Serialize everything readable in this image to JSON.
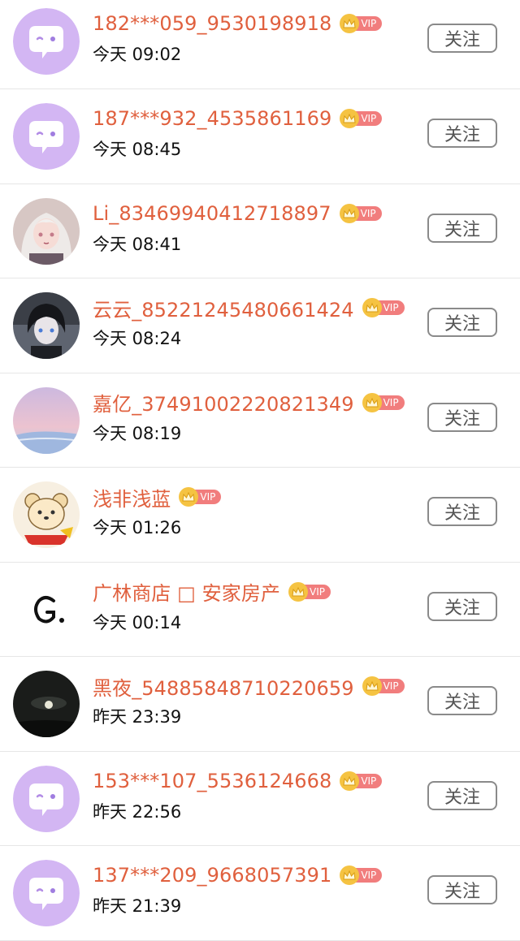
{
  "colors": {
    "username": "#e0603e",
    "vip_gold": "#f5c342",
    "vip_tag": "#f17d7d",
    "border": "#e6e6e6"
  },
  "follow_label": "关注",
  "vip_label": "VIP",
  "users": [
    {
      "name": "182***059_9530198918",
      "time": "今天 09:02",
      "avatar": "default-chat-avatar"
    },
    {
      "name": "187***932_4535861169",
      "time": "今天 08:45",
      "avatar": "default-chat-avatar"
    },
    {
      "name": "Li_83469940412718897",
      "time": "今天 08:41",
      "avatar": "anime-girl-avatar"
    },
    {
      "name": "云云_85221245480661424",
      "time": "今天 08:24",
      "avatar": "dark-hair-anime-avatar"
    },
    {
      "name": "嘉亿_37491002220821349",
      "time": "今天 08:19",
      "avatar": "pink-sky-avatar"
    },
    {
      "name": "浅非浅蓝",
      "time": "今天 01:26",
      "avatar": "bear-cartoon-avatar"
    },
    {
      "name": "广林商店 □ 安家房产",
      "time": "今天 00:14",
      "avatar": "letter-g-avatar"
    },
    {
      "name": "黑夜_54885848710220659",
      "time": "昨天 23:39",
      "avatar": "night-sky-avatar"
    },
    {
      "name": "153***107_5536124668",
      "time": "昨天 22:56",
      "avatar": "default-chat-avatar"
    },
    {
      "name": "137***209_9668057391",
      "time": "昨天 21:39",
      "avatar": "default-chat-avatar"
    }
  ]
}
